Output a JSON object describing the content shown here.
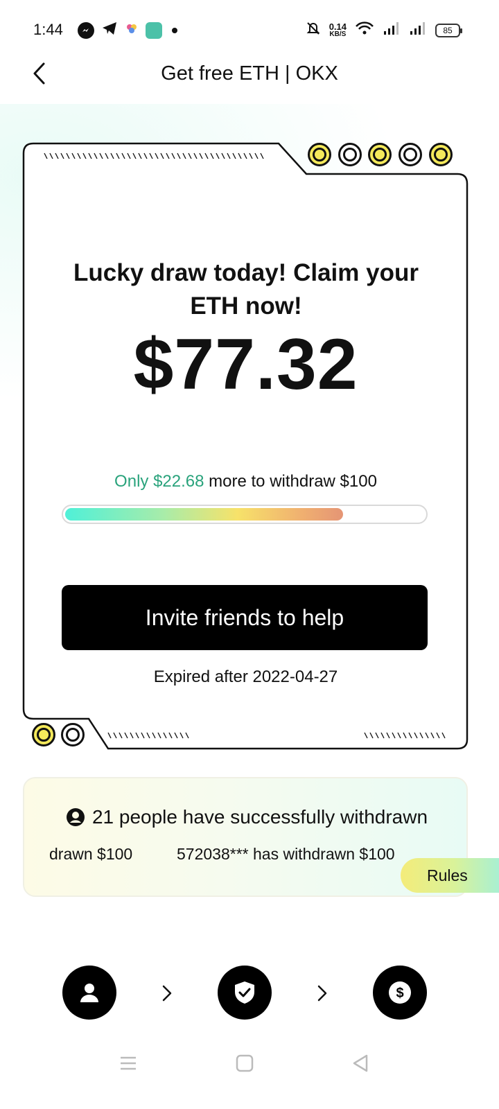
{
  "status_bar": {
    "time": "1:44",
    "net_speed_value": "0.14",
    "net_speed_unit": "KB/S",
    "battery": "85"
  },
  "header": {
    "title": "Get free ETH | OKX"
  },
  "card": {
    "title": "Lucky draw today! Claim your ETH now!",
    "amount": "$77.32",
    "progress_prefix": "Only",
    "progress_highlight": "$22.68",
    "progress_suffix": "more to withdraw $100",
    "progress_fraction": 0.7732,
    "invite_label": "Invite friends to help",
    "expiry": "Expired after 2022-04-27"
  },
  "withdraw_panel": {
    "headline": "21 people have successfully withdrawn",
    "ticker": [
      "drawn $100",
      "572038*** has withdrawn $100"
    ],
    "rules_label": "Rules"
  },
  "steps": [
    {
      "icon": "user-icon"
    },
    {
      "icon": "shield-check-icon"
    },
    {
      "icon": "dollar-coin-icon"
    }
  ],
  "colors": {
    "accent_green": "#2aa37c",
    "coin_gold": "#f4e95b",
    "button_black": "#000000"
  }
}
